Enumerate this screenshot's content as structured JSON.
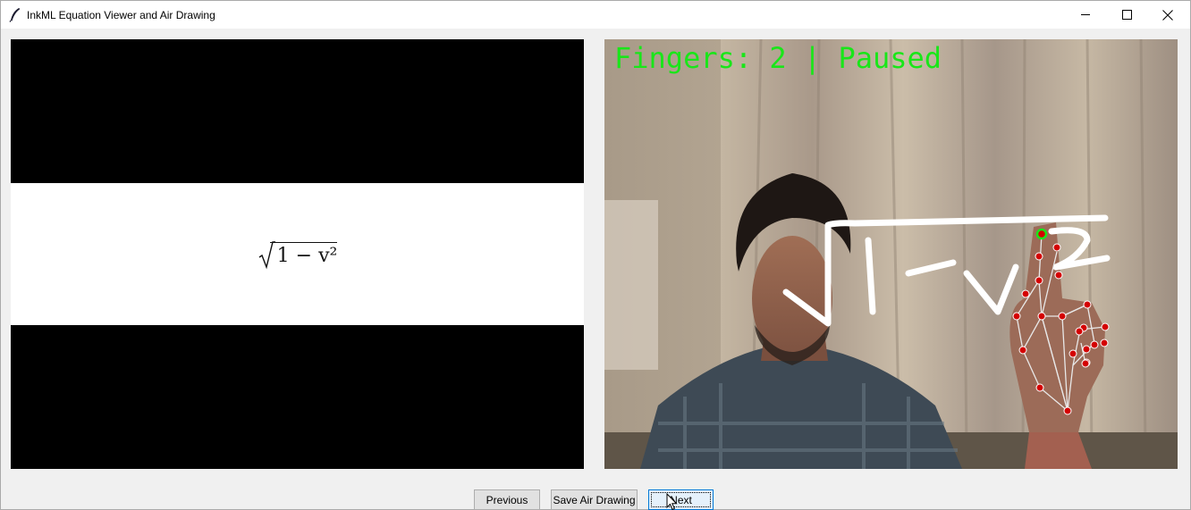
{
  "window": {
    "title": "InkML Equation Viewer and Air Drawing",
    "icon": "feather-icon",
    "controls": [
      "minimize-icon",
      "maximize-icon",
      "close-icon"
    ]
  },
  "equation_panel": {
    "equation_text": "1 − v²"
  },
  "camera_panel": {
    "status_text": "Fingers: 2 | Paused",
    "status_color": "#19e619",
    "landmark_color": "#d40000",
    "active_landmark_color": "#19e619"
  },
  "buttons": {
    "previous_label": "Previous",
    "save_label": "Save Air Drawing",
    "next_label": "Next"
  }
}
